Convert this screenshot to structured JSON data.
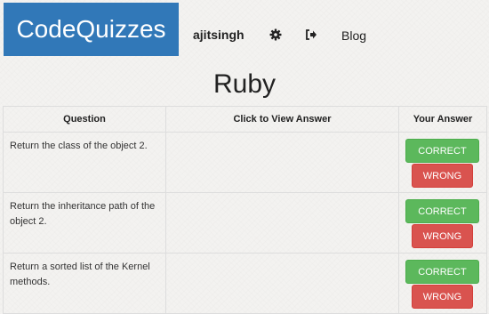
{
  "navbar": {
    "brand": "CodeQuizzes",
    "username": "ajitsingh",
    "settings_icon": "gear-icon",
    "logout_icon": "sign-out-icon",
    "blog_label": "Blog",
    "brand_color": "#3178b8"
  },
  "page": {
    "title": "Ruby"
  },
  "table": {
    "headers": {
      "question": "Question",
      "answer": "Click to View Answer",
      "your_answer": "Your Answer"
    },
    "rows": [
      {
        "question": "Return the class of the object 2.",
        "answer": "",
        "correct_label": "CORRECT",
        "wrong_label": "WRONG"
      },
      {
        "question": "Return the inheritance path of the object 2.",
        "answer": "",
        "correct_label": "CORRECT",
        "wrong_label": "WRONG"
      },
      {
        "question": "Return a sorted list of the Kernel methods.",
        "answer": "",
        "correct_label": "CORRECT",
        "wrong_label": "WRONG"
      }
    ]
  },
  "colors": {
    "correct": "#5cb85c",
    "wrong": "#d9534f",
    "background": "#f3f2f0"
  }
}
